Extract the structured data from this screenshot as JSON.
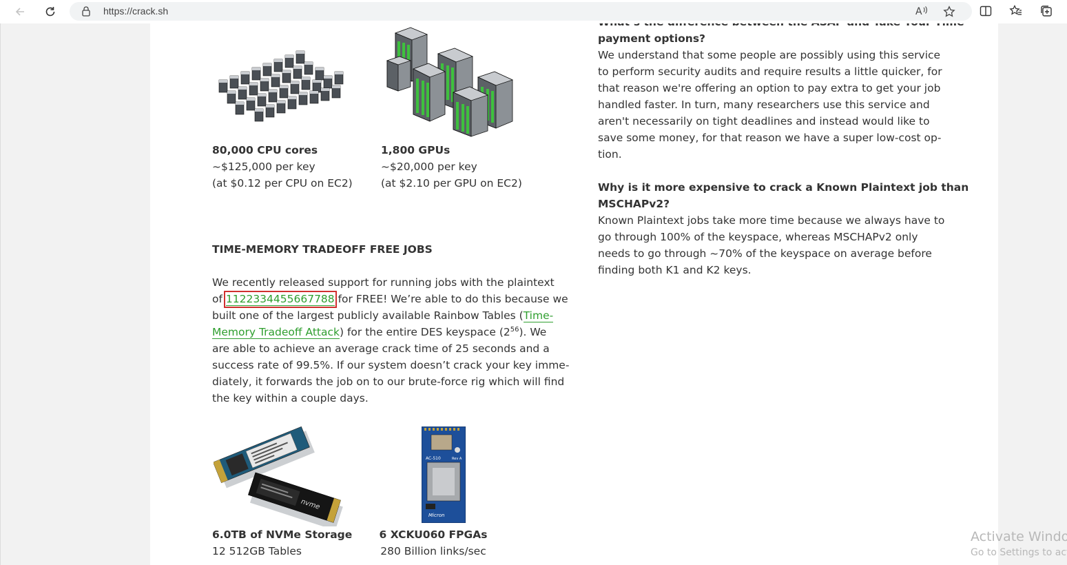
{
  "browser": {
    "url": "https://crack.sh"
  },
  "left": {
    "hw1": {
      "title": "80,000 CPU cores",
      "line1": "~$125,000 per key",
      "line2": "(at $0.12 per CPU on EC2)"
    },
    "hw2": {
      "title": "1,800 GPUs",
      "line1": "~$20,000 per key",
      "line2": "(at $2.10 per GPU on EC2)"
    },
    "section_title": "TIME-MEMORY TRADEOFF FREE JOBS",
    "para": {
      "l1": "We recently released support for running jobs with the plaintext",
      "l2a": "of ",
      "l2_link": "1122334455667788",
      "l2b": " for FREE! We’re able to do this because we",
      "l3a": "built one of the largest publicly available Rainbow Tables (",
      "l3_link": "Time-",
      "l4_link": "Memory Tradeoff Attack",
      "l4b": ") for the entire DES keyspace (2",
      "l4_sup": "56",
      "l4c": "). We",
      "l5": "are able to achieve an average crack time of 25 seconds and a",
      "l6": "success rate of 99.5%. If our system doesn’t crack your key imme-",
      "l7": "diately, it forwards the job on to our brute-force rig which will find",
      "l8": "the key within a couple days."
    },
    "hw3": {
      "title": "6.0TB of NVMe Storage",
      "line1": "12 512GB Tables"
    },
    "hw4": {
      "title": "6 XCKU060 FPGAs",
      "line1": "280 Billion links/sec"
    }
  },
  "right": {
    "q1_partial": "What’s the difference between the ASAP and Take Your Time",
    "q1_title": "payment options?",
    "a1": [
      "We understand that some people are possibly using this service",
      "to perform security audits and require results a little quicker, for",
      "that reason we're offering an option to pay extra to get your job",
      "handled faster. In turn, many researchers use this service and",
      "aren't necessarily on tight deadlines and instead would like to",
      "save some money, for that reason we have a super low-cost op-",
      "tion."
    ],
    "q2_l1": "Why is it more expensive to crack a Known Plaintext job than",
    "q2_l2": "MSCHAPv2?",
    "a2": [
      "Known Plaintext jobs take more time because we always have to",
      "go through 100% of the keyspace, whereas MSCHAPv2 only",
      "needs to go through ~70% of the keyspace on average before",
      "finding both K1 and K2 keys."
    ]
  },
  "watermark": {
    "line1": "Activate Windows",
    "line2": "Go to Settings to activate Windows."
  }
}
